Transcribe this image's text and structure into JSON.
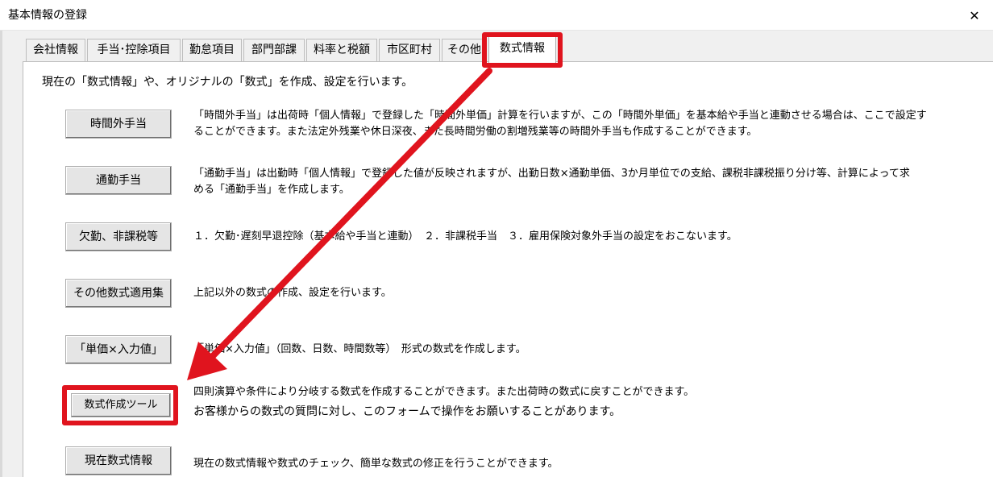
{
  "window": {
    "title": "基本情報の登録",
    "close_glyph": "✕"
  },
  "tabs": [
    {
      "label": "会社情報",
      "active": false
    },
    {
      "label": "手当･控除項目",
      "active": false
    },
    {
      "label": "勤怠項目",
      "active": false
    },
    {
      "label": "部門部課",
      "active": false
    },
    {
      "label": "料率と税額",
      "active": false
    },
    {
      "label": "市区町村",
      "active": false
    },
    {
      "label": "その他",
      "active": false
    },
    {
      "label": "数式情報",
      "active": true
    }
  ],
  "intro": "現在の「数式情報」や、オリジナルの「数式」を作成、設定を行います。",
  "rows": [
    {
      "button": "時間外手当",
      "desc": [
        "「時間外手当」は出荷時「個人情報」で登録した「時間外単価」計算を行いますが、この「時間外単価」を基本給や手当と連動させる場合は、ここで設定す",
        "ることができます。また法定外残業や休日深夜、また長時間労働の割増残業等の時間外手当も作成することができます。"
      ]
    },
    {
      "button": "通勤手当",
      "desc": [
        "「通勤手当」は出勤時「個人情報」で登録した値が反映されますが、出勤日数×通勤単価、3か月単位での支給、課税非課税振り分け等、計算によって求",
        "める「通勤手当」を作成します。"
      ]
    },
    {
      "button": "欠勤、非課税等",
      "desc": [
        "１．欠勤･遅刻早退控除（基本給や手当と連動）　２．非課税手当　３．雇用保険対象外手当の設定をおこないます。"
      ]
    },
    {
      "button": "その他数式適用集",
      "desc": [
        "上記以外の数式の作成、設定を行います。"
      ]
    },
    {
      "button": "「単価×入力値」",
      "desc": [
        "「単価×入力値」（回数、日数、時間数等）　形式の数式を作成します。"
      ]
    },
    {
      "button": "数式作成ツール",
      "desc": [
        "四則演算や条件により分岐する数式を作成することができます。また出荷時の数式に戻すことができます。",
        "お客様からの数式の質問に対し、このフォームで操作をお願いすることがあります。"
      ]
    },
    {
      "button": "現在数式情報",
      "desc": [
        "現在の数式情報や数式のチェック、簡単な数式の修正を行うことができます。"
      ]
    }
  ],
  "annotation": {
    "highlight_color": "#e0141e"
  }
}
